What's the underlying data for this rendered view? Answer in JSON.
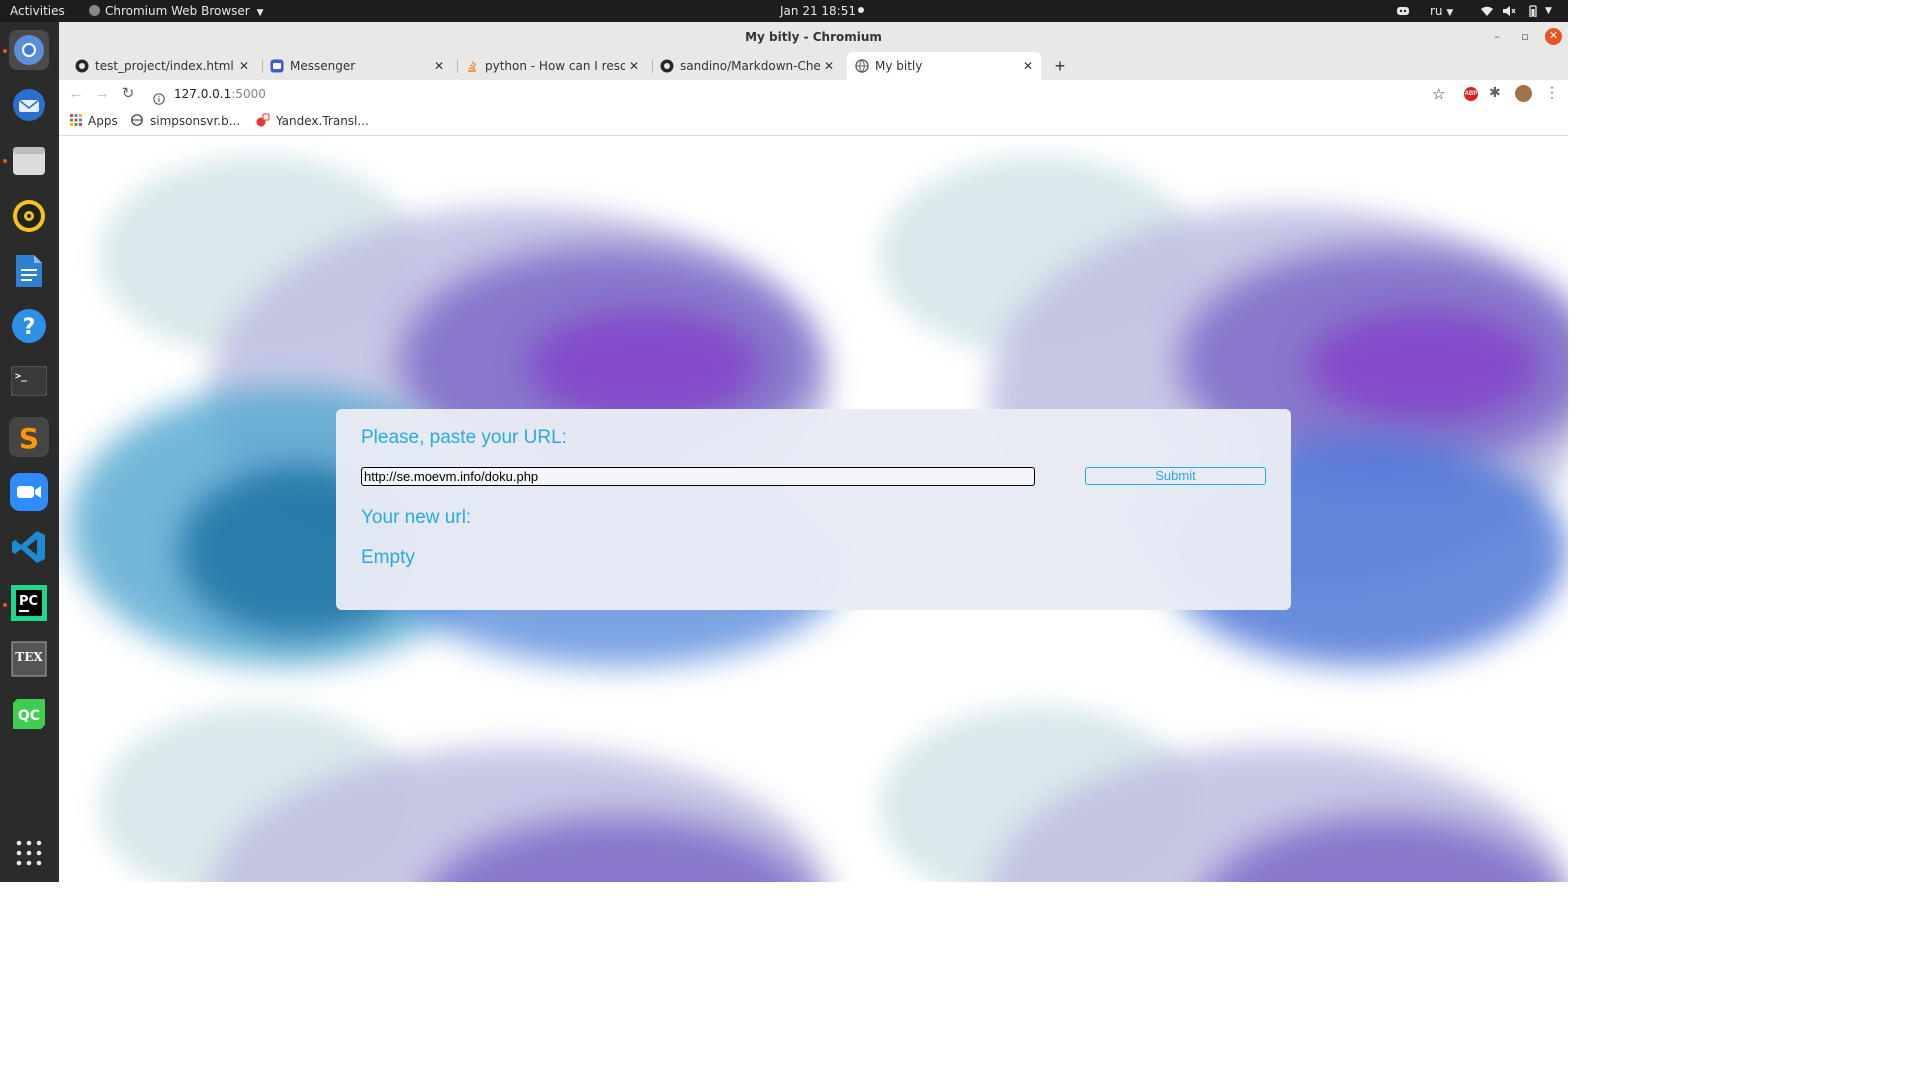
{
  "topbar": {
    "activities": "Activities",
    "app_menu": "Chromium Web Browser",
    "datetime": "Jan 21  18:51",
    "keyboard_layout": "ru"
  },
  "window": {
    "title": "My bitly - Chromium"
  },
  "tabs": [
    {
      "title": "test_project/index.html a",
      "icon": "github-icon",
      "active": false
    },
    {
      "title": "Messenger",
      "icon": "messenger-icon",
      "active": false
    },
    {
      "title": "python - How can I resolve",
      "icon": "stackoverflow-icon",
      "active": false
    },
    {
      "title": "sandino/Markdown-Cheat",
      "icon": "github-icon",
      "active": false
    },
    {
      "title": "My bitly",
      "icon": "globe-icon",
      "active": true
    }
  ],
  "toolbar": {
    "url_host": "127.0.0.1",
    "url_port": ":5000"
  },
  "bookmarks": [
    {
      "label": "Apps",
      "icon": "apps-grid-icon"
    },
    {
      "label": "simpsonsvr.b...",
      "icon": "globe-icon"
    },
    {
      "label": "Yandex.Transl...",
      "icon": "yandex-translate-icon"
    }
  ],
  "page": {
    "prompt_label": "Please, paste your URL:",
    "url_value": "http://se.moevm.info/doku.php",
    "submit_label": "Submit",
    "result_label": "Your new url:",
    "result_value": "Empty"
  },
  "dock": [
    {
      "name": "chromium",
      "label": ""
    },
    {
      "name": "thunderbird",
      "label": ""
    },
    {
      "name": "files",
      "label": ""
    },
    {
      "name": "rhythmbox",
      "label": ""
    },
    {
      "name": "libreoffice-writer",
      "label": ""
    },
    {
      "name": "help",
      "label": "?"
    },
    {
      "name": "terminal",
      "label": ">_"
    },
    {
      "name": "sublime-text",
      "label": "S"
    },
    {
      "name": "zoom",
      "label": ""
    },
    {
      "name": "vscode",
      "label": ""
    },
    {
      "name": "pycharm",
      "label": "PC"
    },
    {
      "name": "texmaker",
      "label": "TEX"
    },
    {
      "name": "qt-creator",
      "label": "QC"
    }
  ],
  "colors": {
    "accent": "#29a9e6",
    "card_bg": "#e8ebf4",
    "topbar_bg": "#1d1d1d",
    "dock_bg": "#2b2b2b"
  }
}
